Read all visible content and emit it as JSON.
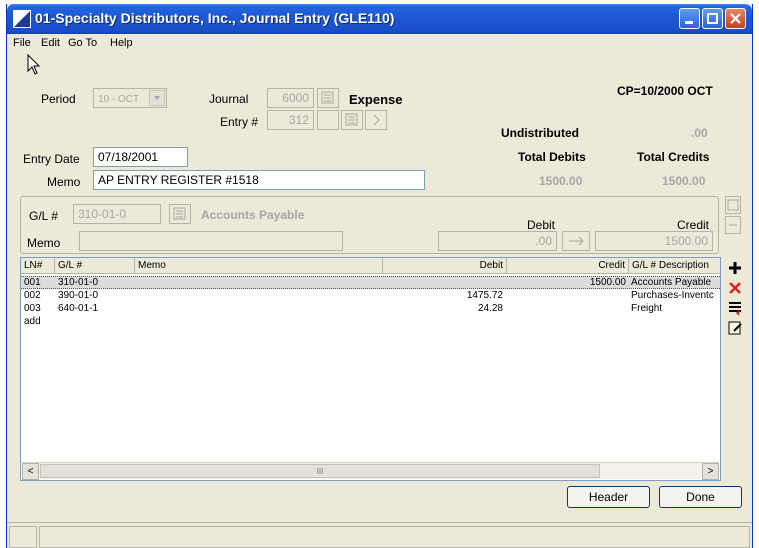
{
  "window": {
    "title": "01-Specialty Distributors, Inc., Journal Entry (GLE110)"
  },
  "menu": [
    "File",
    "Edit",
    "Go To",
    "Help"
  ],
  "header": {
    "period_label": "Period",
    "period_value": "10 - OCT",
    "journal_label": "Journal",
    "journal_value": "6000",
    "journal_name": "Expense",
    "entry_label": "Entry #",
    "entry_value": "312",
    "cp_text": "CP=10/2000 OCT",
    "entry_date_label": "Entry Date",
    "entry_date_value": "07/18/2001",
    "memo_label": "Memo",
    "memo_value": "AP ENTRY REGISTER #1518"
  },
  "totals": {
    "undistributed_label": "Undistributed",
    "undistributed_value": ".00",
    "total_debits_label": "Total Debits",
    "total_credits_label": "Total Credits",
    "total_debits_value": "1500.00",
    "total_credits_value": "1500.00"
  },
  "line_detail": {
    "gl_label": "G/L #",
    "gl_value": "310-01-0",
    "gl_description": "Accounts Payable",
    "memo_label": "Memo",
    "memo_value": "",
    "debit_label": "Debit",
    "credit_label": "Credit",
    "debit_value": ".00",
    "credit_value": "1500.00"
  },
  "grid": {
    "columns": [
      "LN#",
      "G/L #",
      "Memo",
      "Debit",
      "Credit",
      "G/L # Description"
    ],
    "rows": [
      {
        "ln": "001",
        "gl": "310-01-0",
        "memo": "",
        "debit": "",
        "credit": "1500.00",
        "desc": "Accounts Payable"
      },
      {
        "ln": "002",
        "gl": "390-01-0",
        "memo": "",
        "debit": "1475.72",
        "credit": "",
        "desc": "Purchases-Inventc"
      },
      {
        "ln": "003",
        "gl": "640-01-1",
        "memo": "",
        "debit": "24.28",
        "credit": "",
        "desc": "Freight"
      },
      {
        "ln": "add",
        "gl": "",
        "memo": "",
        "debit": "",
        "credit": "",
        "desc": ""
      }
    ],
    "scroll_left": "<",
    "scroll_right": ">",
    "scroll_thumb": "III"
  },
  "buttons": {
    "header": "Header",
    "done": "Done"
  },
  "colors": {
    "title_bar": "#1e58d4",
    "window_bg": "#ece9d8",
    "disabled_text": "#a6a6a6"
  }
}
